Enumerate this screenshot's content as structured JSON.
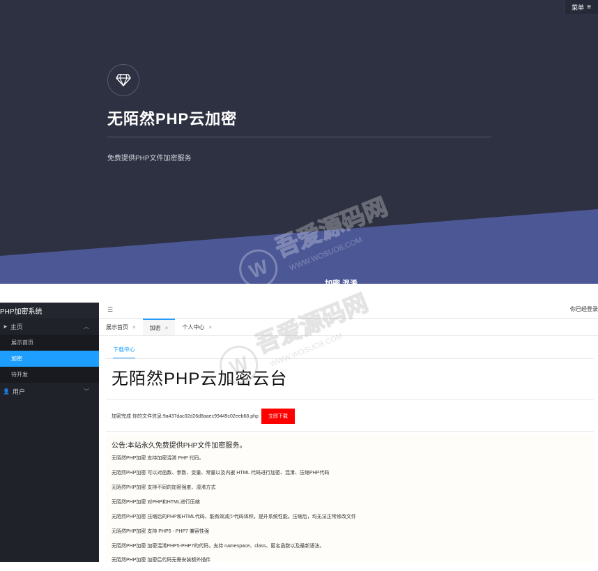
{
  "hero": {
    "menu_label": "菜单",
    "title": "无陌然PHP云加密",
    "subtitle": "免费提供PHP文件加密服务",
    "cut_text": "加密 混淆",
    "colors": {
      "bg": "#2e3141",
      "band": "#4c5796"
    }
  },
  "admin": {
    "brand": "PHP加密系统",
    "sidebar": {
      "groups": [
        {
          "label": "主页",
          "items": [
            "展示首页",
            "加密",
            "待开发"
          ]
        },
        {
          "label": "用户"
        }
      ]
    },
    "topbar": {
      "login_text": "你已经登录"
    },
    "tabs": [
      {
        "label": "展示首页"
      },
      {
        "label": "加密",
        "active": true
      },
      {
        "label": "个人中心"
      }
    ],
    "card_tab": "下载中心",
    "big_title": "无陌然PHP云加密云台",
    "download": {
      "info": "加密完成 你的文件信息:9a437dac02d26d8aaec99449c02eeb68.php",
      "button": "立即下载"
    },
    "notice": {
      "title": "公告:本站永久免费提供PHP文件加密服务。",
      "lines": [
        "无陌然PHP加密 支持加密混淆 PHP 代码。",
        "无陌然PHP加密 可以对函数、参数、变量、常量以及内嵌 HTML 代码进行加密、混淆、压缩PHP代码",
        "无陌然PHP加密 支持不同的加密强度、混淆方式",
        "无陌然PHP加密 对PHP和HTML进行压缩",
        "无陌然PHP加密 压缩后的PHP和HTML代码，能有效减少代码体积，提升系统性能。压缩后，均无法正常修改文件",
        "无陌然PHP加密 支持 PHP5 - PHP7 兼容性强",
        "无陌然PHP加密 加密混淆PHP5-PHP7的代码，支持 namespace、class、匿名函数以及最新语法。",
        "无陌然PHP加密 加密后代码无需安装额外插件"
      ]
    },
    "accent": "#1e9fff",
    "danger": "#ff0000"
  },
  "watermark": {
    "main": "吾爱源码网",
    "url": "WWW.WOSUO8.COM",
    "letter": "W"
  }
}
